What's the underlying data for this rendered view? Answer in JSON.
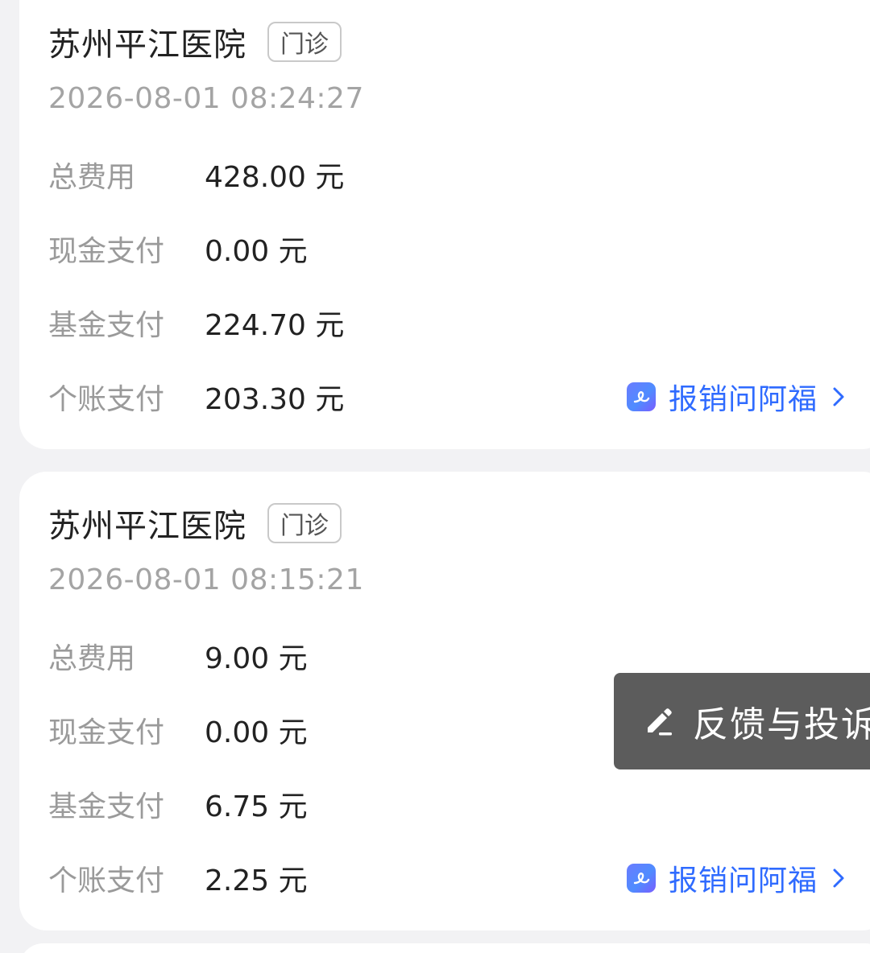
{
  "records": [
    {
      "hospital": "苏州平江医院",
      "visit_type": "门诊",
      "datetime": "2026-08-01 08:24:27",
      "rows": [
        {
          "label": "总费用",
          "value": "428.00 元"
        },
        {
          "label": "现金支付",
          "value": "0.00 元"
        },
        {
          "label": "基金支付",
          "value": "224.70 元"
        },
        {
          "label": "个账支付",
          "value": "203.30 元"
        }
      ],
      "action_label": "报销问阿福"
    },
    {
      "hospital": "苏州平江医院",
      "visit_type": "门诊",
      "datetime": "2026-08-01 08:15:21",
      "rows": [
        {
          "label": "总费用",
          "value": "9.00 元"
        },
        {
          "label": "现金支付",
          "value": "0.00 元"
        },
        {
          "label": "基金支付",
          "value": "6.75 元"
        },
        {
          "label": "个账支付",
          "value": "2.25 元"
        }
      ],
      "action_label": "报销问阿福"
    }
  ],
  "feedback_button": {
    "label": "反馈与投诉",
    "icon": "edit-pencil-icon"
  },
  "icons": {
    "assistant": "ai-assistant-icon",
    "chevron": "chevron-right-icon"
  },
  "colors": {
    "accent": "#2f6bff",
    "label_gray": "#9a9a9a",
    "floating_bg": "#5c5c5c"
  }
}
